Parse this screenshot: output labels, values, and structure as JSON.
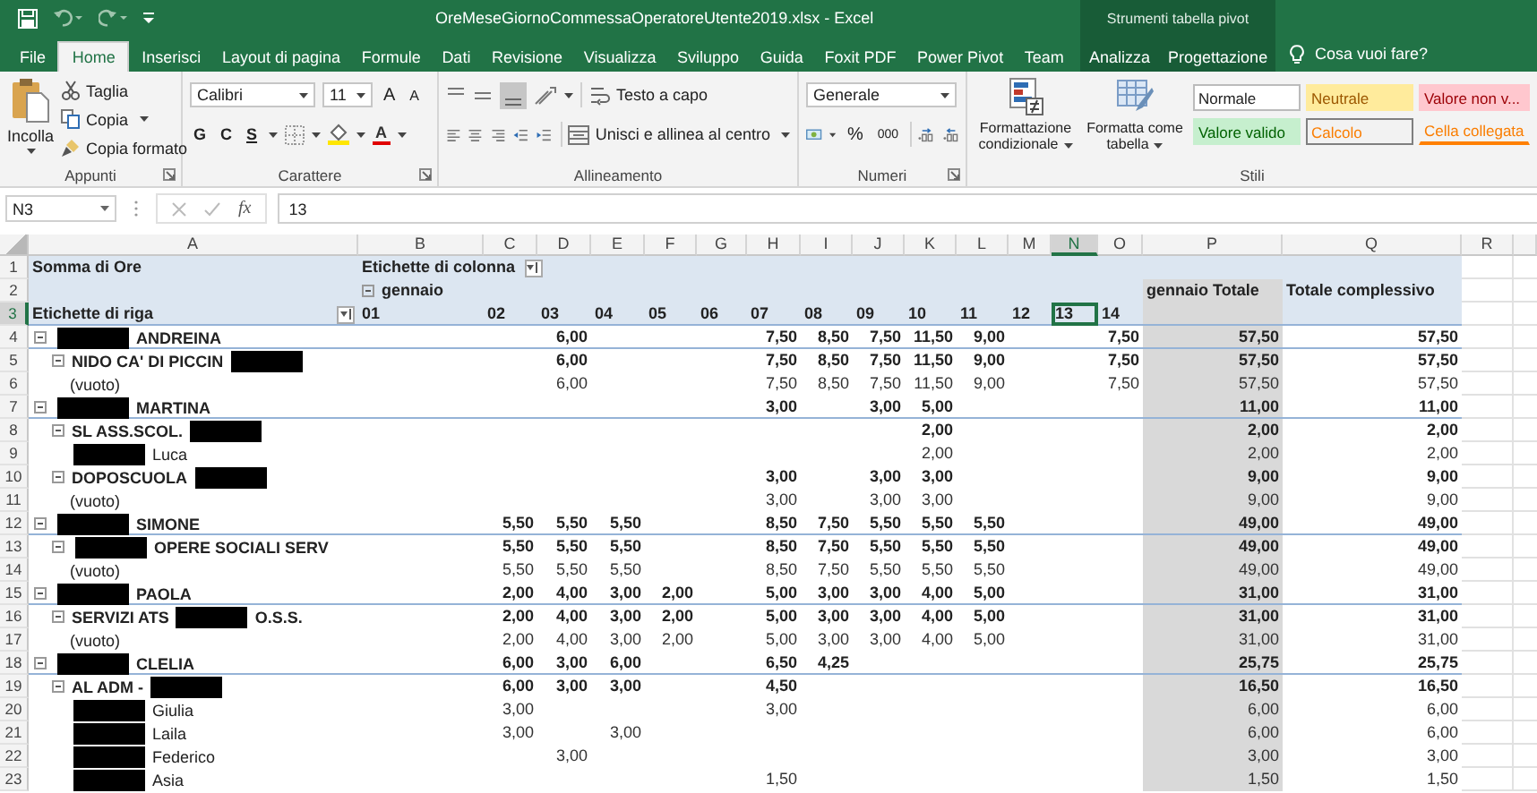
{
  "title_bar": {
    "title": "OreMeseGiornoCommessaOperatoreUtente2019.xlsx  -  Excel",
    "context": "Strumenti tabella pivot"
  },
  "tabs": [
    {
      "label": "File",
      "selected": false,
      "kind": "main"
    },
    {
      "label": "Home",
      "selected": true,
      "kind": "main"
    },
    {
      "label": "Inserisci",
      "selected": false,
      "kind": "main"
    },
    {
      "label": "Layout di pagina",
      "selected": false,
      "kind": "main"
    },
    {
      "label": "Formule",
      "selected": false,
      "kind": "main"
    },
    {
      "label": "Dati",
      "selected": false,
      "kind": "main"
    },
    {
      "label": "Revisione",
      "selected": false,
      "kind": "main"
    },
    {
      "label": "Visualizza",
      "selected": false,
      "kind": "main"
    },
    {
      "label": "Sviluppo",
      "selected": false,
      "kind": "main"
    },
    {
      "label": "Guida",
      "selected": false,
      "kind": "main"
    },
    {
      "label": "Foxit PDF",
      "selected": false,
      "kind": "main"
    },
    {
      "label": "Power Pivot",
      "selected": false,
      "kind": "main"
    },
    {
      "label": "Team",
      "selected": false,
      "kind": "main"
    },
    {
      "label": "Analizza",
      "selected": false,
      "kind": "context"
    },
    {
      "label": "Progettazione",
      "selected": false,
      "kind": "context"
    }
  ],
  "tell_me": "Cosa vuoi fare?",
  "clipboard": {
    "paste": "Incolla",
    "cut": "Taglia",
    "copy": "Copia",
    "format_painter": "Copia formato",
    "group": "Appunti"
  },
  "font": {
    "family": "Calibri",
    "size": "11",
    "grow": "A",
    "shrink": "A",
    "bold": "G",
    "italic": "C",
    "underline": "S",
    "font_color_button": "A",
    "group": "Carattere"
  },
  "alignment": {
    "wrap": "Testo a capo",
    "merge": "Unisci e allinea al centro",
    "group": "Allineamento"
  },
  "number": {
    "format": "Generale",
    "percent": "%",
    "thousands": "000",
    "group": "Numeri"
  },
  "styles": {
    "conditional": "Formattazione condizionale",
    "table": "Formatta come tabella",
    "group": "Stili",
    "cells": [
      {
        "label": "Normale",
        "kind": "normal"
      },
      {
        "label": "Neutrale",
        "kind": "neutral"
      },
      {
        "label": "Valore non v...",
        "kind": "bad"
      },
      {
        "label": "Valore valido",
        "kind": "good"
      },
      {
        "label": "Calcolo",
        "kind": "calc"
      },
      {
        "label": "Cella collegata",
        "kind": "linked"
      }
    ]
  },
  "formula_bar": {
    "name_box": "N3",
    "fx": "fx",
    "value": "13"
  },
  "columns": [
    {
      "label": "A",
      "selected": false
    },
    {
      "label": "B",
      "selected": false
    },
    {
      "label": "C",
      "selected": false
    },
    {
      "label": "D",
      "selected": false
    },
    {
      "label": "E",
      "selected": false
    },
    {
      "label": "F",
      "selected": false
    },
    {
      "label": "G",
      "selected": false
    },
    {
      "label": "H",
      "selected": false
    },
    {
      "label": "I",
      "selected": false
    },
    {
      "label": "J",
      "selected": false
    },
    {
      "label": "K",
      "selected": false
    },
    {
      "label": "L",
      "selected": false
    },
    {
      "label": "M",
      "selected": false
    },
    {
      "label": "N",
      "selected": true
    },
    {
      "label": "O",
      "selected": false
    },
    {
      "label": "P",
      "selected": false
    },
    {
      "label": "Q",
      "selected": false
    },
    {
      "label": "R",
      "selected": false
    }
  ],
  "row_numbers": [
    {
      "label": "1",
      "selected": false
    },
    {
      "label": "2",
      "selected": false
    },
    {
      "label": "3",
      "selected": true
    },
    {
      "label": "4",
      "selected": false
    },
    {
      "label": "5",
      "selected": false
    },
    {
      "label": "6",
      "selected": false
    },
    {
      "label": "7",
      "selected": false
    },
    {
      "label": "8",
      "selected": false
    },
    {
      "label": "9",
      "selected": false
    },
    {
      "label": "10",
      "selected": false
    },
    {
      "label": "11",
      "selected": false
    },
    {
      "label": "12",
      "selected": false
    },
    {
      "label": "13",
      "selected": false
    },
    {
      "label": "14",
      "selected": false
    },
    {
      "label": "15",
      "selected": false
    },
    {
      "label": "16",
      "selected": false
    },
    {
      "label": "17",
      "selected": false
    },
    {
      "label": "18",
      "selected": false
    },
    {
      "label": "19",
      "selected": false
    },
    {
      "label": "20",
      "selected": false
    },
    {
      "label": "21",
      "selected": false
    },
    {
      "label": "22",
      "selected": false
    },
    {
      "label": "23",
      "selected": false
    }
  ],
  "pivot": {
    "value_field": "Somma di Ore",
    "column_labels": "Etichette di colonna",
    "month": "gennaio",
    "month_expanded": true,
    "row_labels": "Etichette di riga",
    "days": [
      {
        "label": "01",
        "selected": false
      },
      {
        "label": "02",
        "selected": false
      },
      {
        "label": "03",
        "selected": false
      },
      {
        "label": "04",
        "selected": false
      },
      {
        "label": "05",
        "selected": false
      },
      {
        "label": "06",
        "selected": false
      },
      {
        "label": "07",
        "selected": false
      },
      {
        "label": "08",
        "selected": false
      },
      {
        "label": "09",
        "selected": false
      },
      {
        "label": "10",
        "selected": false
      },
      {
        "label": "11",
        "selected": false
      },
      {
        "label": "12",
        "selected": false
      },
      {
        "label": "13",
        "selected": true
      },
      {
        "label": "14",
        "selected": false
      }
    ],
    "month_total": "gennaio Totale",
    "grand_total": "Totale complessivo",
    "rows": [
      {
        "label": [
          {
            "kind": "redaction"
          },
          {
            "kind": "text",
            "text": "ANDREINA"
          }
        ],
        "expanded": true,
        "values": {
          "03": "6,00",
          "07": "7,50",
          "08": "8,50",
          "09": "7,50",
          "10": "11,50",
          "11": "9,00",
          "14": "7,50"
        },
        "total": "57,50",
        "grand_total": "57,50",
        "children": [
          {
            "label": [
              {
                "kind": "text",
                "text": "NIDO CA' DI PICCIN"
              },
              {
                "kind": "redaction"
              }
            ],
            "expanded": true,
            "values": {
              "03": "6,00",
              "07": "7,50",
              "08": "8,50",
              "09": "7,50",
              "10": "11,50",
              "11": "9,00",
              "14": "7,50"
            },
            "total": "57,50",
            "grand_total": "57,50",
            "children": [
              {
                "label": [
                  {
                    "kind": "text",
                    "text": "(vuoto)"
                  }
                ],
                "values": {
                  "03": "6,00",
                  "07": "7,50",
                  "08": "8,50",
                  "09": "7,50",
                  "10": "11,50",
                  "11": "9,00",
                  "14": "7,50"
                },
                "total": "57,50",
                "grand_total": "57,50"
              }
            ]
          }
        ]
      },
      {
        "label": [
          {
            "kind": "redaction"
          },
          {
            "kind": "text",
            "text": "MARTINA"
          }
        ],
        "expanded": true,
        "values": {
          "07": "3,00",
          "09": "3,00",
          "10": "5,00"
        },
        "total": "11,00",
        "grand_total": "11,00",
        "children": [
          {
            "label": [
              {
                "kind": "text",
                "text": "SL ASS.SCOL."
              },
              {
                "kind": "redaction"
              }
            ],
            "expanded": true,
            "values": {
              "10": "2,00"
            },
            "total": "2,00",
            "grand_total": "2,00",
            "children": [
              {
                "label": [
                  {
                    "kind": "redaction"
                  },
                  {
                    "kind": "text",
                    "text": "Luca"
                  }
                ],
                "values": {
                  "10": "2,00"
                },
                "total": "2,00",
                "grand_total": "2,00"
              }
            ]
          },
          {
            "label": [
              {
                "kind": "text",
                "text": "DOPOSCUOLA"
              },
              {
                "kind": "redaction"
              }
            ],
            "expanded": true,
            "values": {
              "07": "3,00",
              "09": "3,00",
              "10": "3,00"
            },
            "total": "9,00",
            "grand_total": "9,00",
            "children": [
              {
                "label": [
                  {
                    "kind": "text",
                    "text": "(vuoto)"
                  }
                ],
                "values": {
                  "07": "3,00",
                  "09": "3,00",
                  "10": "3,00"
                },
                "total": "9,00",
                "grand_total": "9,00"
              }
            ]
          }
        ]
      },
      {
        "label": [
          {
            "kind": "redaction"
          },
          {
            "kind": "text",
            "text": "SIMONE"
          }
        ],
        "expanded": true,
        "values": {
          "02": "5,50",
          "03": "5,50",
          "04": "5,50",
          "07": "8,50",
          "08": "7,50",
          "09": "5,50",
          "10": "5,50",
          "11": "5,50"
        },
        "total": "49,00",
        "grand_total": "49,00",
        "children": [
          {
            "label": [
              {
                "kind": "redaction"
              },
              {
                "kind": "text",
                "text": "OPERE SOCIALI SERV"
              }
            ],
            "expanded": true,
            "values": {
              "02": "5,50",
              "03": "5,50",
              "04": "5,50",
              "07": "8,50",
              "08": "7,50",
              "09": "5,50",
              "10": "5,50",
              "11": "5,50"
            },
            "total": "49,00",
            "grand_total": "49,00",
            "children": [
              {
                "label": [
                  {
                    "kind": "text",
                    "text": "(vuoto)"
                  }
                ],
                "values": {
                  "02": "5,50",
                  "03": "5,50",
                  "04": "5,50",
                  "07": "8,50",
                  "08": "7,50",
                  "09": "5,50",
                  "10": "5,50",
                  "11": "5,50"
                },
                "total": "49,00",
                "grand_total": "49,00"
              }
            ]
          }
        ]
      },
      {
        "label": [
          {
            "kind": "redaction"
          },
          {
            "kind": "text",
            "text": "PAOLA"
          }
        ],
        "expanded": true,
        "values": {
          "02": "2,00",
          "03": "4,00",
          "04": "3,00",
          "05": "2,00",
          "07": "5,00",
          "08": "3,00",
          "09": "3,00",
          "10": "4,00",
          "11": "5,00"
        },
        "total": "31,00",
        "grand_total": "31,00",
        "children": [
          {
            "label": [
              {
                "kind": "text",
                "text": "SERVIZI ATS"
              },
              {
                "kind": "redaction"
              },
              {
                "kind": "text",
                "text": "O.S.S."
              }
            ],
            "expanded": true,
            "values": {
              "02": "2,00",
              "03": "4,00",
              "04": "3,00",
              "05": "2,00",
              "07": "5,00",
              "08": "3,00",
              "09": "3,00",
              "10": "4,00",
              "11": "5,00"
            },
            "total": "31,00",
            "grand_total": "31,00",
            "children": [
              {
                "label": [
                  {
                    "kind": "text",
                    "text": "(vuoto)"
                  }
                ],
                "values": {
                  "02": "2,00",
                  "03": "4,00",
                  "04": "3,00",
                  "05": "2,00",
                  "07": "5,00",
                  "08": "3,00",
                  "09": "3,00",
                  "10": "4,00",
                  "11": "5,00"
                },
                "total": "31,00",
                "grand_total": "31,00"
              }
            ]
          }
        ]
      },
      {
        "label": [
          {
            "kind": "redaction"
          },
          {
            "kind": "text",
            "text": "CLELIA"
          }
        ],
        "expanded": true,
        "values": {
          "02": "6,00",
          "03": "3,00",
          "04": "6,00",
          "07": "6,50",
          "08": "4,25"
        },
        "total": "25,75",
        "grand_total": "25,75",
        "children": [
          {
            "label": [
              {
                "kind": "text",
                "text": "AL ADM -"
              },
              {
                "kind": "redaction"
              }
            ],
            "expanded": true,
            "values": {
              "02": "6,00",
              "03": "3,00",
              "04": "3,00",
              "07": "4,50"
            },
            "total": "16,50",
            "grand_total": "16,50",
            "children": [
              {
                "label": [
                  {
                    "kind": "redaction"
                  },
                  {
                    "kind": "text",
                    "text": "Giulia"
                  }
                ],
                "values": {
                  "02": "3,00",
                  "07": "3,00"
                },
                "total": "6,00",
                "grand_total": "6,00"
              },
              {
                "label": [
                  {
                    "kind": "redaction"
                  },
                  {
                    "kind": "text",
                    "text": "Laila"
                  }
                ],
                "values": {
                  "02": "3,00",
                  "04": "3,00"
                },
                "total": "6,00",
                "grand_total": "6,00"
              },
              {
                "label": [
                  {
                    "kind": "redaction"
                  },
                  {
                    "kind": "text",
                    "text": "Federico"
                  }
                ],
                "values": {
                  "03": "3,00"
                },
                "total": "3,00",
                "grand_total": "3,00"
              },
              {
                "label": [
                  {
                    "kind": "redaction"
                  },
                  {
                    "kind": "text",
                    "text": "Asia"
                  }
                ],
                "values": {
                  "07": "1,50"
                },
                "total": "1,50",
                "grand_total": "1,50"
              }
            ]
          }
        ]
      }
    ]
  }
}
